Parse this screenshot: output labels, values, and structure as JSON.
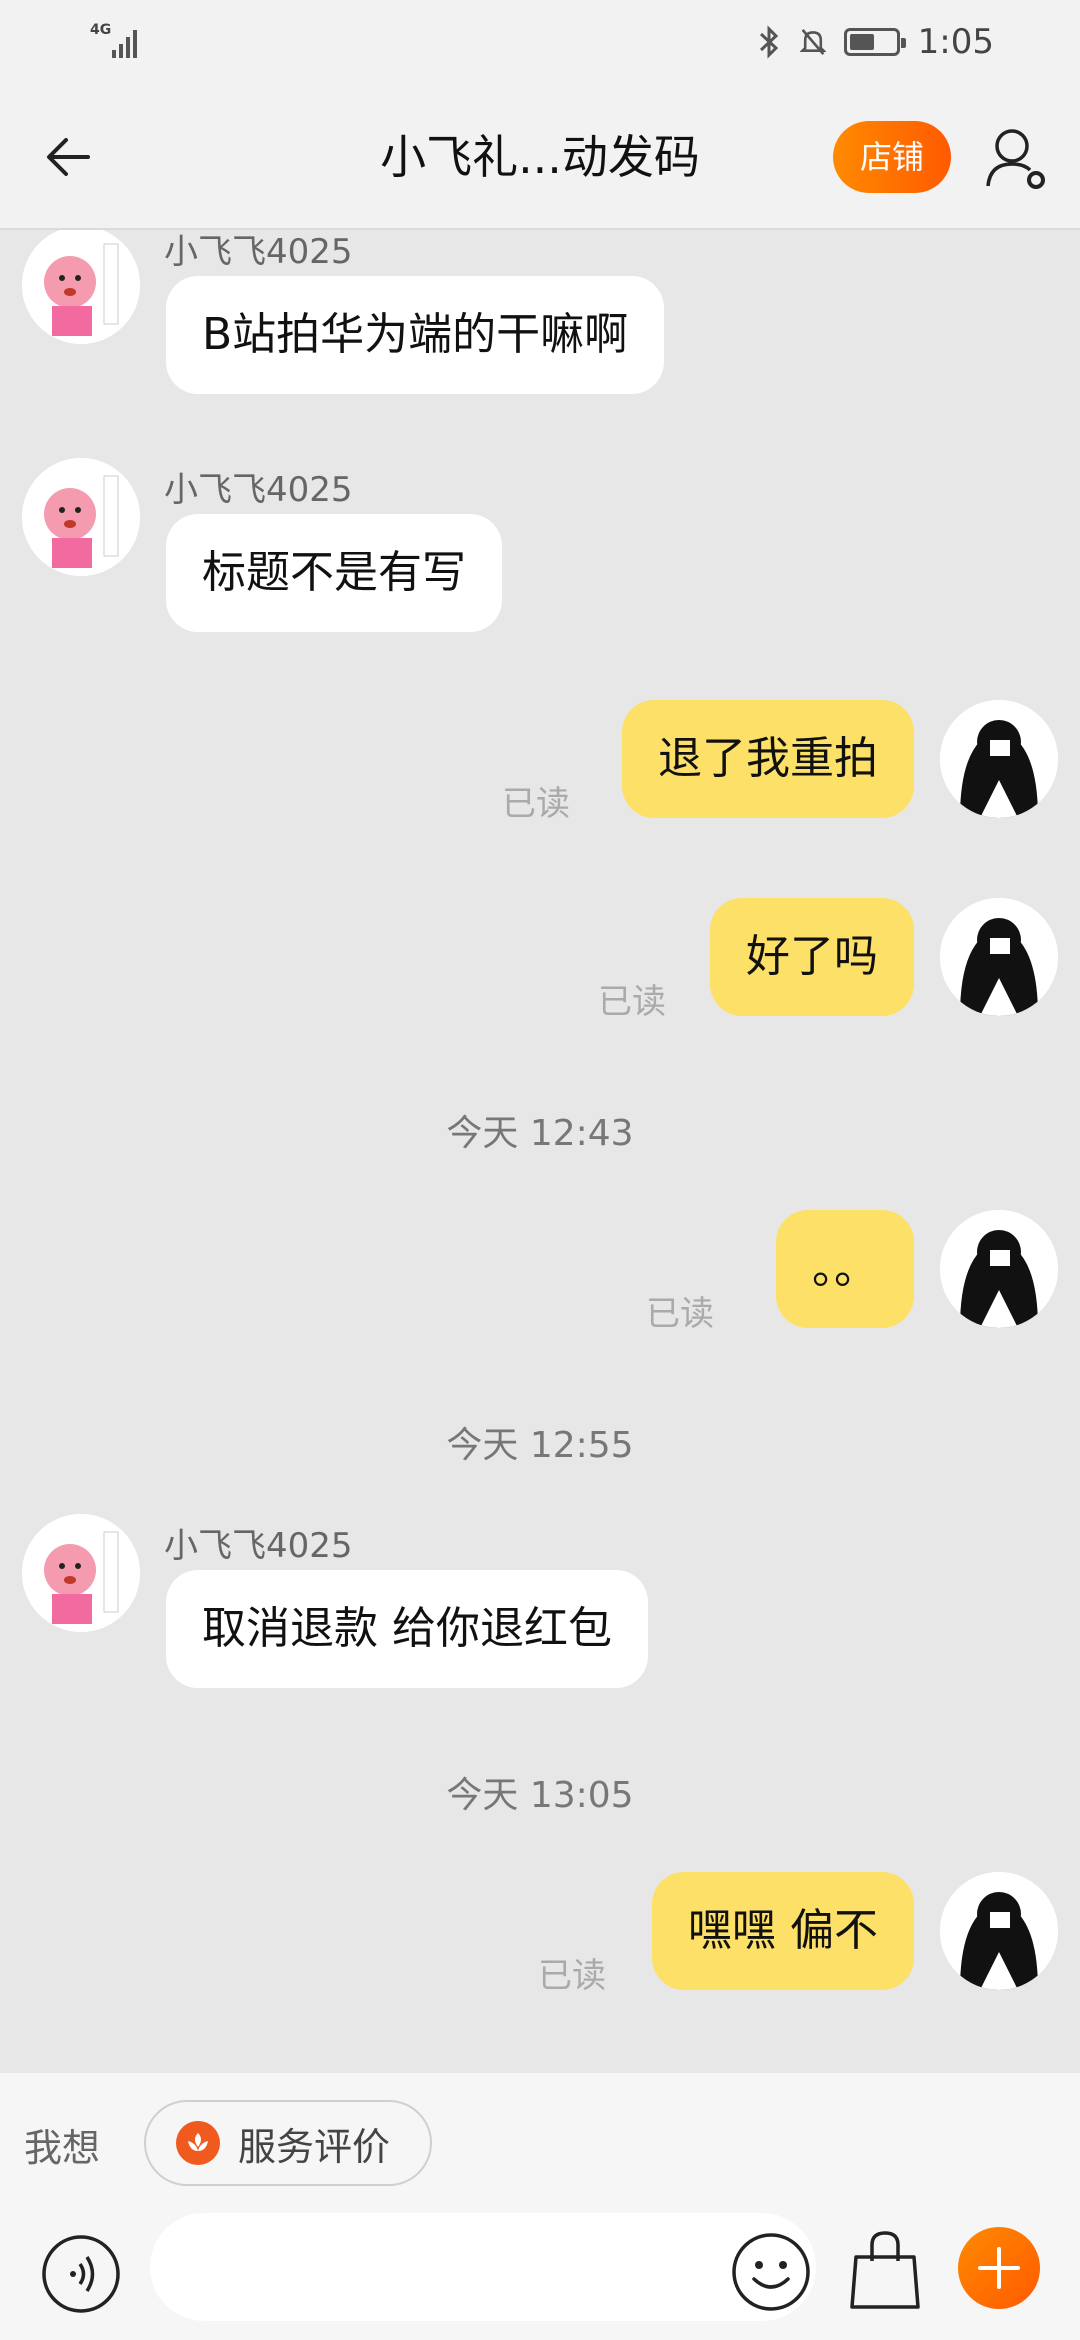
{
  "status_bar": {
    "network": "4G",
    "time": "1:05",
    "battery_level": 0.55
  },
  "header": {
    "title": "小飞礼...动发码",
    "shop_label": "店铺"
  },
  "chat": {
    "incoming_sender": "小飞飞4025",
    "messages": [
      {
        "direction": "in",
        "sender": "小飞飞4025",
        "text": "B站拍华为端的干嘛啊"
      },
      {
        "direction": "in",
        "sender": "小飞飞4025",
        "text": "标题不是有写"
      },
      {
        "direction": "out",
        "text": "退了我重拍",
        "status": "已读"
      },
      {
        "direction": "out",
        "text": "好了吗",
        "status": "已读"
      },
      {
        "direction": "timestamp",
        "text": "今天  12:43"
      },
      {
        "direction": "out",
        "text": "。。",
        "status": "已读"
      },
      {
        "direction": "timestamp",
        "text": "今天  12:55"
      },
      {
        "direction": "in",
        "sender": "小飞飞4025",
        "text": "取消退款 给你退红包"
      },
      {
        "direction": "timestamp",
        "text": "今天  13:05"
      },
      {
        "direction": "out",
        "text": "嘿嘿 偏不",
        "status": "已读"
      }
    ]
  },
  "quick_bar": {
    "label": "我想",
    "chip_label": "服务评价"
  },
  "input_bar": {
    "placeholder": "",
    "icons": [
      "voice-icon",
      "emoji-icon",
      "bag-icon",
      "plus-icon"
    ]
  },
  "colors": {
    "accent": "#ff6a00",
    "out_bubble": "#fde067",
    "in_bubble": "#ffffff",
    "chat_bg": "#e7e7e7"
  }
}
